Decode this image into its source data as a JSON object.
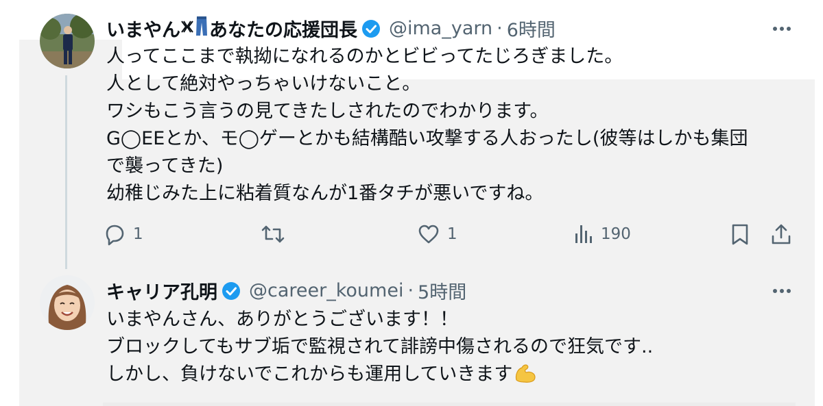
{
  "tweets": [
    {
      "name": "いまやん",
      "name_suffix": "あなたの応援団長",
      "handle": "@ima_yarn",
      "separator": "·",
      "time": "6時間",
      "lines": [
        "人ってここまで執拗になれるのかとビビってたじろぎました。",
        "人として絶対やっちゃいけないこと。",
        "ワシもこう言うの見てきたしされたのでわかります。",
        "G◯EEとか、モ◯ゲーとかも結構酷い攻撃する人おったし(彼等はしかも集団",
        "で襲ってきた)",
        "幼稚じみた上に粘着質なんが1番タチが悪いですね。"
      ],
      "actions": {
        "reply_count": "1",
        "retweet_count": "",
        "like_count": "1",
        "views_count": "190"
      }
    },
    {
      "name": "キャリア孔明",
      "handle": "@career_koumei",
      "separator": "·",
      "time": "5時間",
      "lines": [
        "いまやんさん、ありがとうございます！！",
        "ブロックしてもサブ垢で監視されて誹謗中傷されるので狂気です..",
        "しかし、負けないでこれからも運用していきます"
      ]
    }
  ],
  "colors": {
    "verified": "#1d9bf0",
    "panel_bg": "#f2f2f2",
    "secondary_text": "#536471",
    "primary_text": "#0f1419"
  },
  "icons": {
    "reply": "reply-icon",
    "retweet": "retweet-icon",
    "like": "heart-icon",
    "views": "views-icon",
    "bookmark": "bookmark-icon",
    "share": "share-icon",
    "more": "more-icon",
    "verified": "verified-badge-icon"
  }
}
